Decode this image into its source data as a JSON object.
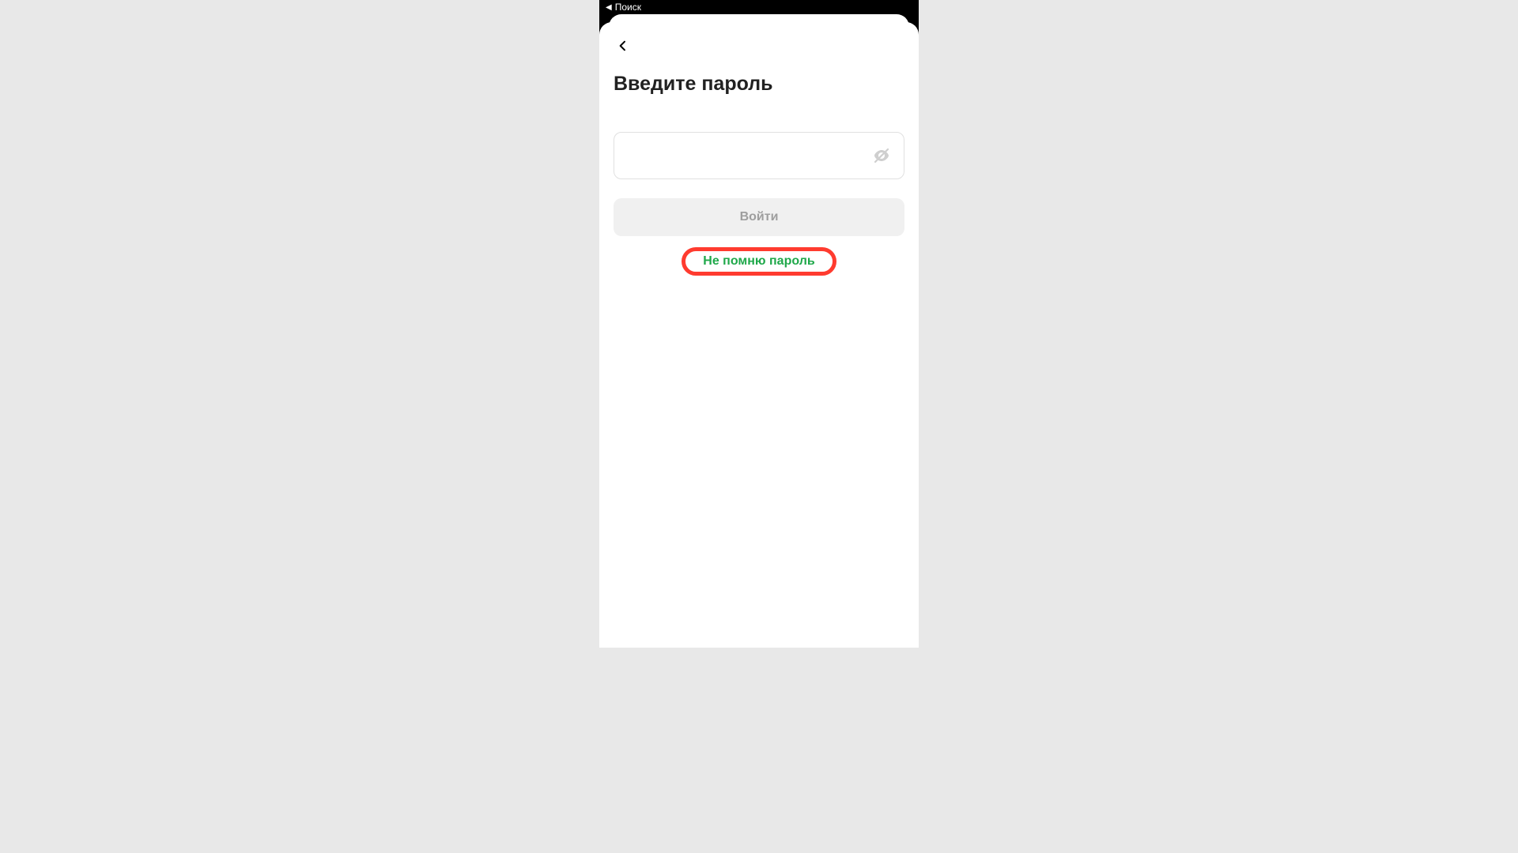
{
  "statusbar": {
    "back_label": "Поиск"
  },
  "screen": {
    "title": "Введите пароль",
    "password_value": "",
    "login_button": "Войти",
    "forgot_password": "Не помню пароль"
  }
}
